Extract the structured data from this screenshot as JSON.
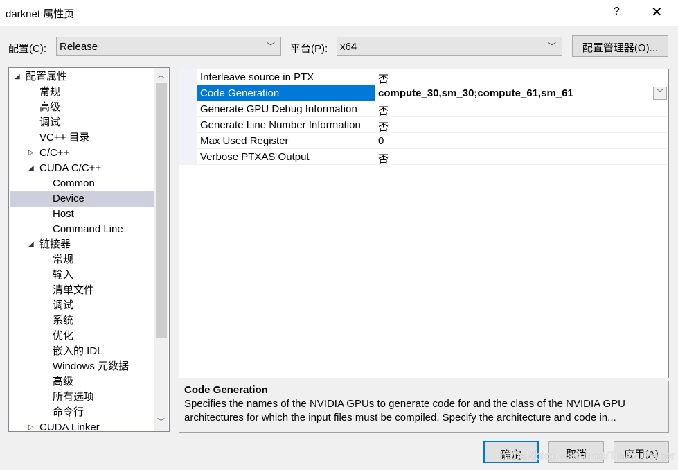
{
  "window": {
    "title": "darknet 属性页",
    "help": "?",
    "close": "✕"
  },
  "config": {
    "config_label": "配置(C):",
    "config_value": "Release",
    "platform_label": "平台(P):",
    "platform_value": "x64",
    "manager_label": "配置管理器(O)..."
  },
  "tree": [
    {
      "label": "配置属性",
      "level": 0,
      "expander": "expanded"
    },
    {
      "label": "常规",
      "level": 1
    },
    {
      "label": "高级",
      "level": 1
    },
    {
      "label": "调试",
      "level": 1
    },
    {
      "label": "VC++ 目录",
      "level": 1
    },
    {
      "label": "C/C++",
      "level": 0.5,
      "expander": "collapsed"
    },
    {
      "label": "CUDA C/C++",
      "level": 0.5,
      "expander": "expanded"
    },
    {
      "label": "Common",
      "level": 2
    },
    {
      "label": "Device",
      "level": 2,
      "selected": true
    },
    {
      "label": "Host",
      "level": 2
    },
    {
      "label": "Command Line",
      "level": 2
    },
    {
      "label": "链接器",
      "level": 0.5,
      "expander": "expanded"
    },
    {
      "label": "常规",
      "level": 2
    },
    {
      "label": "输入",
      "level": 2
    },
    {
      "label": "清单文件",
      "level": 2
    },
    {
      "label": "调试",
      "level": 2
    },
    {
      "label": "系统",
      "level": 2
    },
    {
      "label": "优化",
      "level": 2
    },
    {
      "label": "嵌入的 IDL",
      "level": 2
    },
    {
      "label": "Windows 元数据",
      "level": 2
    },
    {
      "label": "高级",
      "level": 2
    },
    {
      "label": "所有选项",
      "level": 2
    },
    {
      "label": "命令行",
      "level": 2
    },
    {
      "label": "CUDA Linker",
      "level": 0.5,
      "expander": "collapsed"
    }
  ],
  "properties": [
    {
      "name": "Interleave source in PTX",
      "value": "否"
    },
    {
      "name": "Code Generation",
      "value": "compute_30,sm_30;compute_61,sm_61",
      "selected": true
    },
    {
      "name": "Generate GPU Debug Information",
      "value": "否"
    },
    {
      "name": "Generate Line Number Information",
      "value": "否"
    },
    {
      "name": "Max Used Register",
      "value": "0"
    },
    {
      "name": "Verbose PTXAS Output",
      "value": "否"
    }
  ],
  "description": {
    "title": "Code Generation",
    "text": "Specifies the names of the NVIDIA GPUs to generate code for and the class of the NVIDIA GPU architectures for which the input files must be compiled.  Specify the architecture and code in..."
  },
  "buttons": {
    "ok": "确定",
    "cancel": "取消",
    "apply": "应用(A)"
  },
  "watermark": "https://blog.csdn.net/Tracy_Baker",
  "colors": {
    "accent": "#0078d7",
    "tree_selection": "#cdd0dc"
  }
}
